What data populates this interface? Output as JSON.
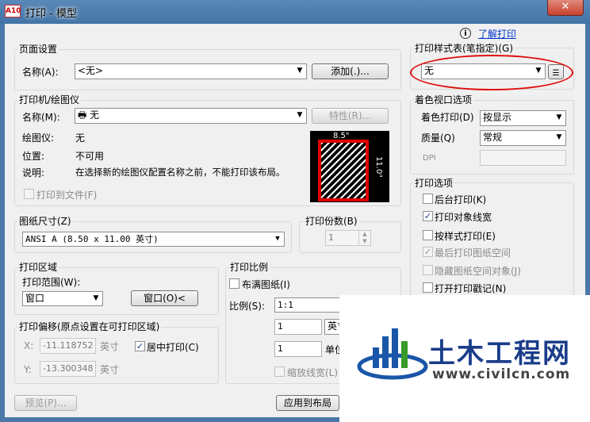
{
  "window": {
    "title": "打印 - 模型",
    "app_icon_text": "A10",
    "close_label": "✕"
  },
  "page_setup": {
    "group_label": "页面设置",
    "name_label": "名称(A):",
    "name_value": "<无>",
    "add_button": "添加(.)..."
  },
  "printer": {
    "group_label": "打印机/绘图仪",
    "name_label": "名称(M):",
    "name_value": "无",
    "properties_button": "特性(R)...",
    "plotter_label": "绘图仪:",
    "plotter_value": "无",
    "location_label": "位置:",
    "location_value": "不可用",
    "description_label": "说明:",
    "description_value": "在选择新的绘图仪配置名称之前，不能打印该布局。",
    "print_to_file_label": "打印到文件(F)",
    "preview_width_label": "8.5\"",
    "preview_height_label": "11.0\""
  },
  "paper_size": {
    "group_label": "图纸尺寸(Z)",
    "value": "ANSI A (8.50 x 11.00 英寸)"
  },
  "copies": {
    "group_label": "打印份数(B)",
    "value": "1"
  },
  "plot_area": {
    "group_label": "打印区域",
    "range_label": "打印范围(W):",
    "range_value": "窗口",
    "window_button": "窗口(O)<"
  },
  "plot_offset": {
    "group_label": "打印偏移(原点设置在可打印区域)",
    "x_label": "X:",
    "x_value": "-11.118752",
    "x_unit": "英寸",
    "y_label": "Y:",
    "y_value": "-13.300348",
    "y_unit": "英寸",
    "center_label": "居中打印(C)"
  },
  "plot_scale": {
    "group_label": "打印比例",
    "fit_label": "布满图纸(I)",
    "scale_label": "比例(S):",
    "scale_value": "1:1",
    "value1": "1",
    "unit1": "英寸",
    "value2": "1",
    "unit2": "单位",
    "lineweights_label": "缩放线宽(L)"
  },
  "footer": {
    "preview_button": "预览(P)...",
    "apply_button": "应用到布局"
  },
  "help": {
    "icon": "i",
    "link": "了解打印"
  },
  "plot_style": {
    "group_label": "打印样式表(笔指定)(G)",
    "value": "无"
  },
  "shaded": {
    "group_label": "着色视口选项",
    "shade_label": "着色打印(D)",
    "shade_value": "按显示",
    "quality_label": "质量(Q)",
    "quality_value": "常规",
    "dpi_label": "DPI"
  },
  "plot_options": {
    "group_label": "打印选项",
    "items": [
      {
        "label": "后台打印(K)",
        "checked": false,
        "enabled": true
      },
      {
        "label": "打印对象线宽",
        "checked": true,
        "enabled": true
      },
      {
        "label": "按样式打印(E)",
        "checked": false,
        "enabled": true
      },
      {
        "label": "最后打印图纸空间",
        "checked": true,
        "enabled": false
      },
      {
        "label": "隐藏图纸空间对象(J)",
        "checked": false,
        "enabled": false
      },
      {
        "label": "打开打印戳记(N)",
        "checked": false,
        "enabled": true
      }
    ]
  },
  "watermark": {
    "title": "土木工程网",
    "url": "www.civilcn.com"
  },
  "colors": {
    "highlight_ellipse": "#e01010",
    "watermark_blue": "#1a56a8",
    "watermark_green": "#3a9a2a"
  }
}
